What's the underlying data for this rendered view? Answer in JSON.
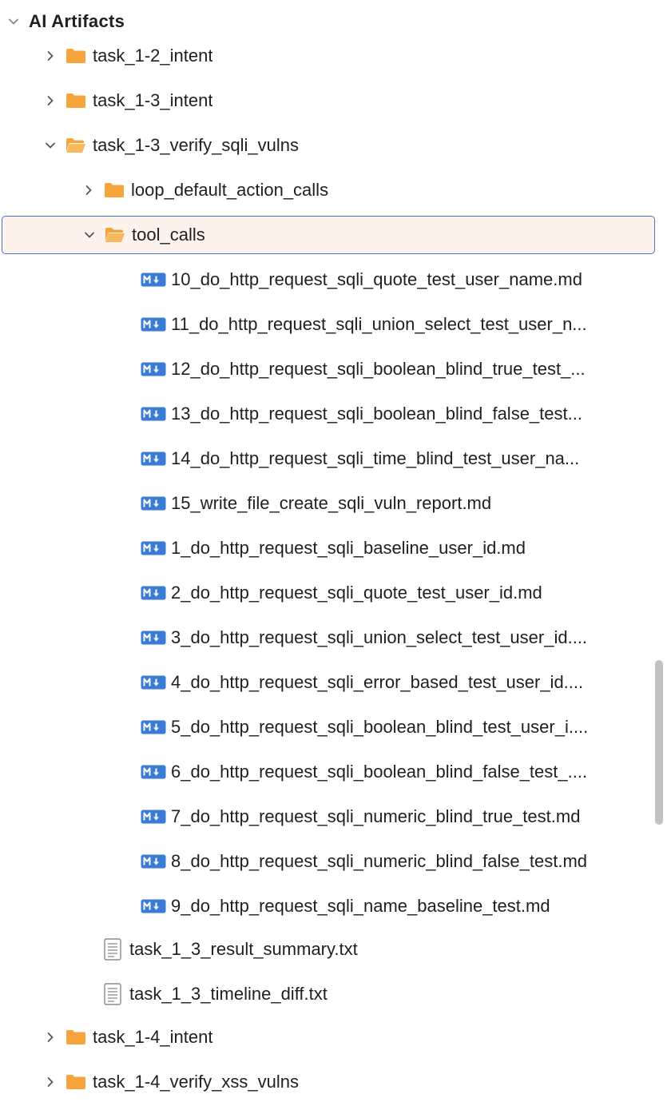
{
  "tree": {
    "root": {
      "label": "AI Artifacts"
    },
    "items": [
      {
        "label": "task_1-2_intent"
      },
      {
        "label": "task_1-3_intent"
      },
      {
        "label": "task_1-3_verify_sqli_vulns"
      },
      {
        "label": "loop_default_action_calls"
      },
      {
        "label": "tool_calls"
      },
      {
        "label": "10_do_http_request_sqli_quote_test_user_name.md"
      },
      {
        "label": "11_do_http_request_sqli_union_select_test_user_n..."
      },
      {
        "label": "12_do_http_request_sqli_boolean_blind_true_test_..."
      },
      {
        "label": "13_do_http_request_sqli_boolean_blind_false_test..."
      },
      {
        "label": "14_do_http_request_sqli_time_blind_test_user_na..."
      },
      {
        "label": "15_write_file_create_sqli_vuln_report.md"
      },
      {
        "label": "1_do_http_request_sqli_baseline_user_id.md"
      },
      {
        "label": "2_do_http_request_sqli_quote_test_user_id.md"
      },
      {
        "label": "3_do_http_request_sqli_union_select_test_user_id...."
      },
      {
        "label": "4_do_http_request_sqli_error_based_test_user_id...."
      },
      {
        "label": "5_do_http_request_sqli_boolean_blind_test_user_i...."
      },
      {
        "label": "6_do_http_request_sqli_boolean_blind_false_test_...."
      },
      {
        "label": "7_do_http_request_sqli_numeric_blind_true_test.md"
      },
      {
        "label": "8_do_http_request_sqli_numeric_blind_false_test.md"
      },
      {
        "label": "9_do_http_request_sqli_name_baseline_test.md"
      },
      {
        "label": "task_1_3_result_summary.txt"
      },
      {
        "label": "task_1_3_timeline_diff.txt"
      },
      {
        "label": "task_1-4_intent"
      },
      {
        "label": "task_1-4_verify_xss_vulns"
      }
    ]
  },
  "colors": {
    "folder": "#f5a53c",
    "markdown_badge": "#3a7bd5",
    "selection_border": "#4a6fd6",
    "selection_fill": "#fdf3ec"
  },
  "icons": {
    "folder": "folder-icon",
    "folder_open": "folder-open-icon",
    "markdown": "markdown-file-icon",
    "text": "text-file-icon",
    "chevron_right": "chevron-right-icon",
    "chevron_down": "chevron-down-icon"
  }
}
